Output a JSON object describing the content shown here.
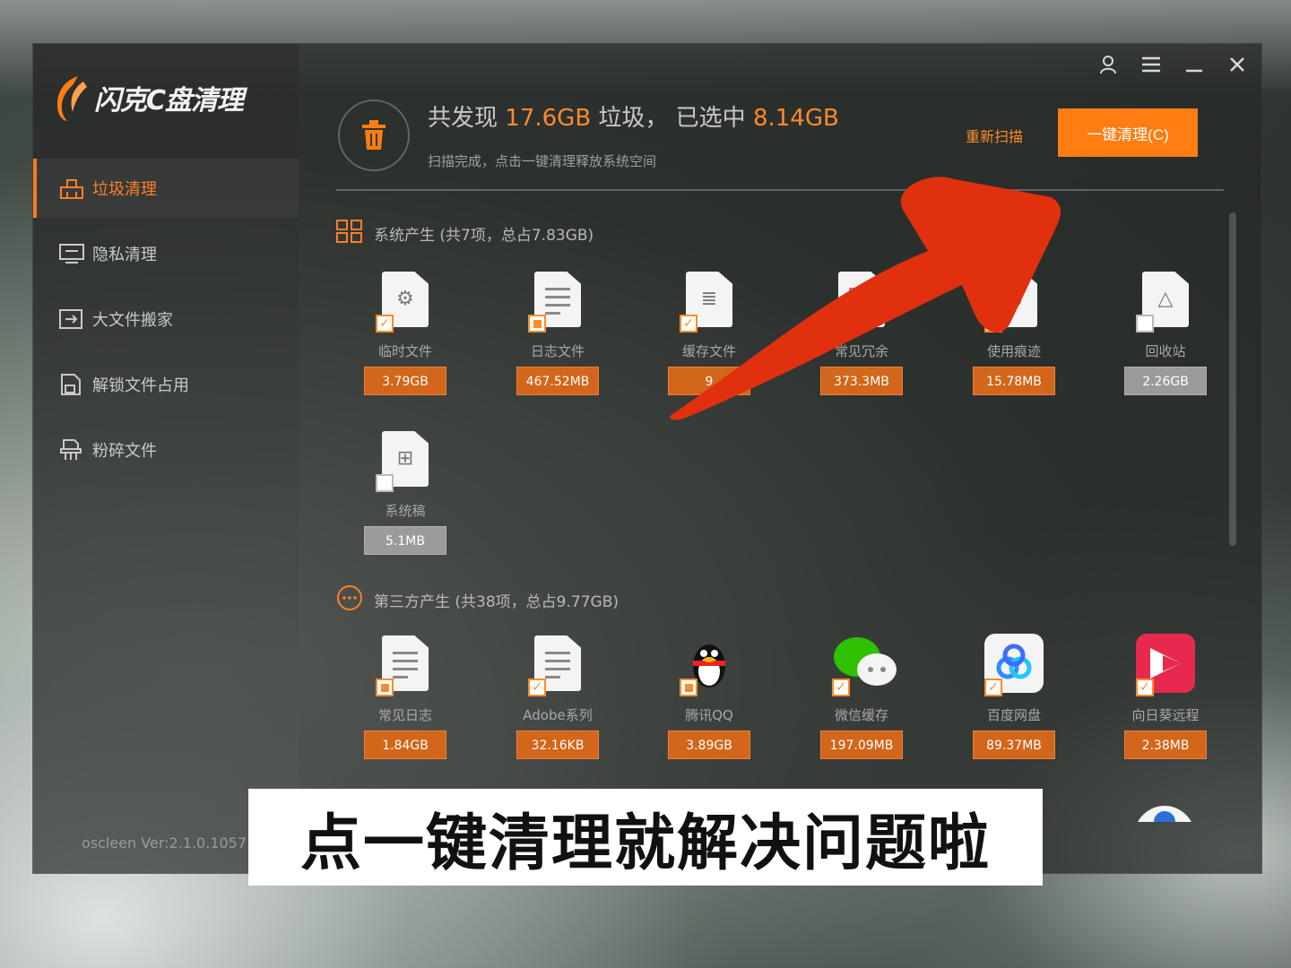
{
  "app": {
    "logo_text": "闪克C盘清理",
    "version": "oscleen Ver:2.1.0.1057"
  },
  "sidebar": {
    "items": [
      {
        "label": "垃圾清理",
        "icon": "broom-icon"
      },
      {
        "label": "隐私清理",
        "icon": "monitor-icon"
      },
      {
        "label": "大文件搬家",
        "icon": "move-file-icon"
      },
      {
        "label": "解锁文件占用",
        "icon": "unlock-file-icon"
      },
      {
        "label": "粉碎文件",
        "icon": "shredder-icon"
      }
    ]
  },
  "header": {
    "summary_prefix": "共发现",
    "total_found": "17.6GB",
    "summary_mid": "垃圾，  已选中",
    "selected": "8.14GB",
    "status": "扫描完成，点击一键清理释放系统空间",
    "rescan_label": "重新扫描",
    "clean_button_label": "一键清理(C)"
  },
  "sections": {
    "system": {
      "title": "系统产生 (共7项，总占7.83GB)",
      "items": [
        {
          "label": "临时文件",
          "size": "3.79GB",
          "icon": "gear-file-icon",
          "check": "checked"
        },
        {
          "label": "日志文件",
          "size": "467.52MB",
          "icon": "log-file-icon",
          "check": "partial"
        },
        {
          "label": "缓存文件",
          "size": "9",
          "icon": "database-file-icon",
          "check": "checked"
        },
        {
          "label": "常见冗余",
          "size": "373.3MB",
          "icon": "redundant-file-icon",
          "check": "checked"
        },
        {
          "label": "使用痕迹",
          "size": "15.78MB",
          "icon": "trace-file-icon",
          "check": "checked"
        },
        {
          "label": "回收站",
          "size": "2.26GB",
          "icon": "recycle-bin-icon",
          "check": "empty"
        },
        {
          "label": "系统稿",
          "size": "5.1MB",
          "icon": "windows-file-icon",
          "check": "empty"
        }
      ]
    },
    "third_party": {
      "title": "第三方产生 (共38项，总占9.77GB)",
      "items": [
        {
          "label": "常见日志",
          "size": "1.84GB",
          "icon": "log-file-icon",
          "check": "partial"
        },
        {
          "label": "Adobe系列",
          "size": "32.16KB",
          "icon": "log-file-icon",
          "check": "checked"
        },
        {
          "label": "腾讯QQ",
          "size": "3.89GB",
          "icon": "qq-penguin-icon",
          "check": "partial"
        },
        {
          "label": "微信缓存",
          "size": "197.09MB",
          "icon": "wechat-icon",
          "check": "checked"
        },
        {
          "label": "百度网盘",
          "size": "89.37MB",
          "icon": "baidu-netdisk-icon",
          "check": "checked"
        },
        {
          "label": "向日葵远程",
          "size": "2.38MB",
          "icon": "sunflower-icon",
          "check": "checked"
        }
      ]
    }
  },
  "caption": "点一键清理就解决问题啦",
  "colors": {
    "accent": "#ff7d12",
    "tag": "#d2661a",
    "arrow": "#e0300e"
  }
}
